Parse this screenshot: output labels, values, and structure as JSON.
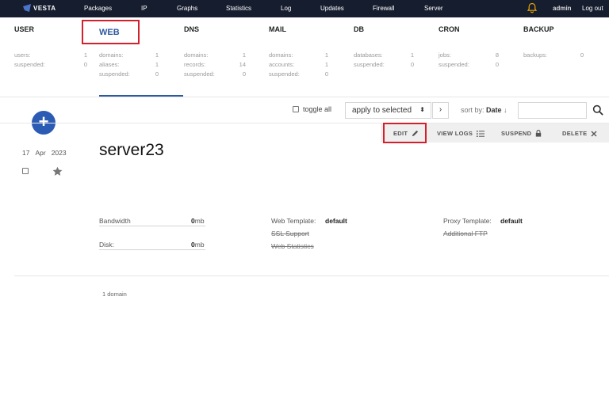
{
  "nav": {
    "logo": "VESTA",
    "items": [
      "Packages",
      "IP",
      "Graphs",
      "Statistics",
      "Log",
      "Updates",
      "Firewall",
      "Server"
    ],
    "user": "admin",
    "logout": "Log out"
  },
  "tabs": [
    {
      "name": "USER",
      "stats": [
        {
          "label": "users:",
          "value": "1"
        },
        {
          "label": "suspended:",
          "value": "0"
        }
      ]
    },
    {
      "name": "WEB",
      "stats": [
        {
          "label": "domains:",
          "value": "1"
        },
        {
          "label": "aliases:",
          "value": "1"
        },
        {
          "label": "suspended:",
          "value": "0"
        }
      ]
    },
    {
      "name": "DNS",
      "stats": [
        {
          "label": "domains:",
          "value": "1"
        },
        {
          "label": "records:",
          "value": "14"
        },
        {
          "label": "suspended:",
          "value": "0"
        }
      ]
    },
    {
      "name": "MAIL",
      "stats": [
        {
          "label": "domains:",
          "value": "1"
        },
        {
          "label": "accounts:",
          "value": "1"
        },
        {
          "label": "suspended:",
          "value": "0"
        }
      ]
    },
    {
      "name": "DB",
      "stats": [
        {
          "label": "databases:",
          "value": "1"
        },
        {
          "label": "suspended:",
          "value": "0"
        }
      ]
    },
    {
      "name": "CRON",
      "stats": [
        {
          "label": "jobs:",
          "value": "8"
        },
        {
          "label": "suspended:",
          "value": "0"
        }
      ]
    },
    {
      "name": "BACKUP",
      "stats": [
        {
          "label": "backups:",
          "value": "0"
        }
      ]
    }
  ],
  "toolbar": {
    "add_label": "+",
    "toggle_all": "toggle all",
    "apply_selected": "apply to selected",
    "apply_arrows": "⬍",
    "go_arrow": "›",
    "sort_prefix": "sort by:",
    "sort_value": "Date",
    "sort_arrow": "↓"
  },
  "actions": {
    "edit": "EDIT",
    "view_logs": "VIEW LOGS",
    "suspend": "SUSPEND",
    "delete": "DELETE"
  },
  "row": {
    "date_day": "17",
    "date_month": "Apr",
    "date_year": "2023",
    "name": "server23",
    "bandwidth_label": "Bandwidth",
    "bandwidth_value": "0",
    "bandwidth_unit": "mb",
    "disk_label": "Disk:",
    "disk_value": "0",
    "disk_unit": "mb",
    "web_template_label": "Web Template:",
    "web_template_value": "default",
    "ssl_support": "SSL Support",
    "web_statistics": "Web Statistics",
    "proxy_template_label": "Proxy Template:",
    "proxy_template_value": "default",
    "additional_ftp": "Additional FTP"
  },
  "footer": {
    "count": "1 domain"
  },
  "colors": {
    "accent": "#2c5aa0",
    "highlight": "#d4202c",
    "nav_bg": "#161d2e",
    "bell": "#f0a500"
  }
}
